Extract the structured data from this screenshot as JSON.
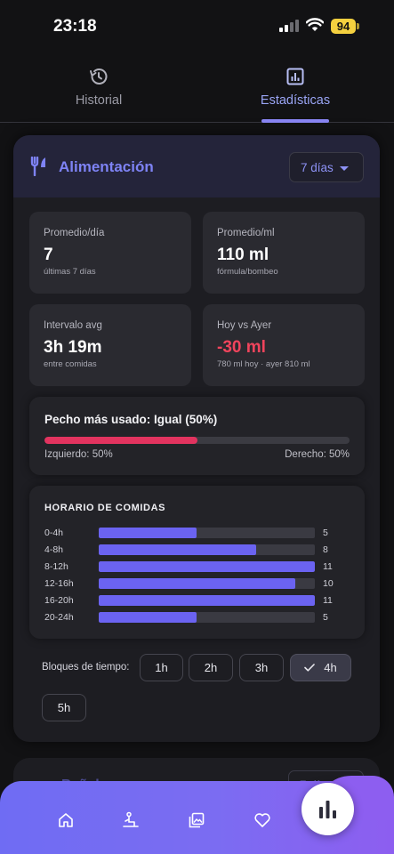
{
  "status_bar": {
    "time": "23:18",
    "battery": "94"
  },
  "tabs": [
    {
      "label": "Historial",
      "icon": "history-icon",
      "active": false
    },
    {
      "label": "Estadísticas",
      "icon": "chart-icon",
      "active": true
    }
  ],
  "feeding": {
    "title": "Alimentación",
    "period": "7 días",
    "stats": [
      {
        "label": "Promedio/día",
        "value": "7",
        "sub": "últimas 7 días"
      },
      {
        "label": "Promedio/ml",
        "value": "110 ml",
        "sub": "fórmula/bombeo"
      },
      {
        "label": "Intervalo avg",
        "value": "3h 19m",
        "sub": "entre comidas"
      },
      {
        "label": "Hoy vs Ayer",
        "value": "-30 ml",
        "sub": "780 ml hoy · ayer 810 ml"
      }
    ],
    "breast": {
      "title": "Pecho más usado: Igual (50%)",
      "left_label": "Izquierdo: 50%",
      "right_label": "Derecho: 50%",
      "left_fraction": 0.5
    },
    "schedule": {
      "title": "HORARIO DE COMIDAS",
      "max": 11,
      "rows": [
        {
          "label": "0-4h",
          "value": 5,
          "value_text": "5"
        },
        {
          "label": "4-8h",
          "value": 8,
          "value_text": "8"
        },
        {
          "label": "8-12h",
          "value": 11,
          "value_text": "11"
        },
        {
          "label": "12-16h",
          "value": 10,
          "value_text": "10"
        },
        {
          "label": "16-20h",
          "value": 11,
          "value_text": "11"
        },
        {
          "label": "20-24h",
          "value": 5,
          "value_text": "5"
        }
      ]
    },
    "blocks": {
      "label": "Bloques de tiempo:",
      "options": [
        "1h",
        "2h",
        "3h",
        "4h",
        "5h"
      ],
      "selected": "4h"
    }
  },
  "next_card": {
    "title": "Pañales",
    "period": "7 días"
  },
  "colors": {
    "accent": "#7e83f5",
    "negative": "#f0445c",
    "breast_fill": "#e2335f",
    "bar_fill": "#6b63f1"
  }
}
